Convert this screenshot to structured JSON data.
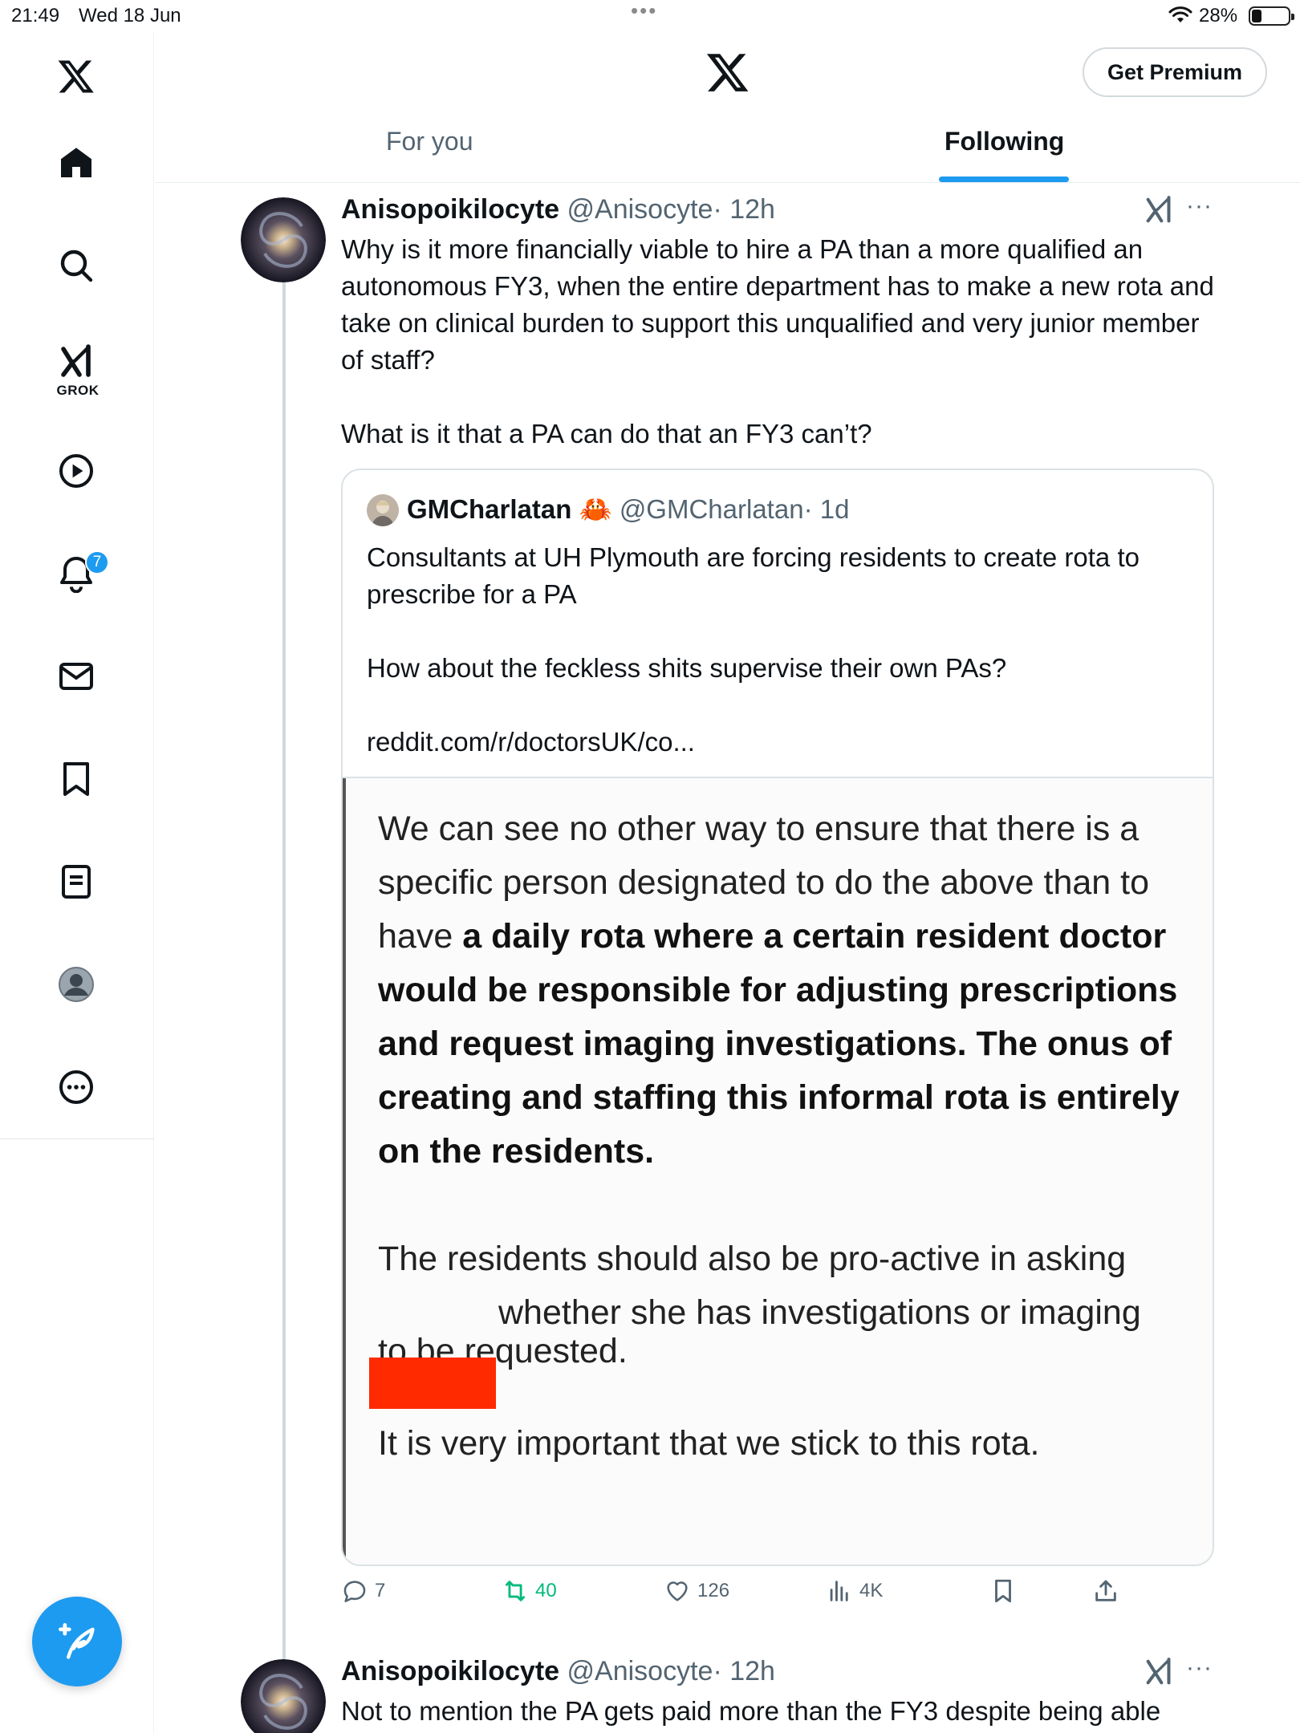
{
  "status_bar": {
    "time": "21:49",
    "date": "Wed 18 Jun",
    "battery_percent": "28%",
    "battery_level": 0.28
  },
  "sidebar": {
    "items": [
      {
        "icon": "x-logo-icon"
      },
      {
        "icon": "home-icon"
      },
      {
        "icon": "search-icon"
      },
      {
        "icon": "grok-icon",
        "label": "GROK"
      },
      {
        "icon": "play-icon"
      },
      {
        "icon": "bell-icon",
        "badge": "7"
      },
      {
        "icon": "mail-icon"
      },
      {
        "icon": "bookmark-icon"
      },
      {
        "icon": "list-icon"
      },
      {
        "icon": "profile-icon"
      },
      {
        "icon": "more-icon"
      }
    ],
    "compose_icon": "compose-icon"
  },
  "header": {
    "premium_label": "Get Premium",
    "tabs": [
      {
        "label": "For you",
        "active": false
      },
      {
        "label": "Following",
        "active": true
      }
    ],
    "accent_color": "#1d9bf0"
  },
  "tweet": {
    "author_name": "Anisopoikilocyte",
    "handle": "@Anisocyte",
    "time": "· 12h",
    "text_p1": "Why is it more financially viable to hire a PA than a more qualified an autonomous FY3, when the entire department has to make a new rota and take on clinical burden to support this unqualified and very junior member of staff?",
    "text_p2": "What is it that a PA can do that an FY3 can’t?",
    "quote": {
      "author_name": "GMCharlatan",
      "emoji": "🦀",
      "handle": "@GMCharlatan",
      "time": "· 1d",
      "text_p1": "Consultants at UH Plymouth are forcing residents to create rota to prescribe for a PA",
      "text_p2": "How about the feckless shits supervise their own PAs?",
      "link": "reddit.com/r/doctorsUK/co...",
      "image_text": {
        "p1_normal": "We can see no other way to ensure that there is a specific person designated to do the above than to have",
        "p1_bold": "a daily rota where a certain resident doctor would be responsible for adjusting prescriptions and request imaging investigations. The onus of creating and staffing this informal rota is entirely on the residents.",
        "p2_line1": "The residents should also be pro-active in asking",
        "p2_line2": "whether she has investigations or imaging",
        "p2_line3": "to be requested.",
        "p3": "It is very important that we stick to this rota."
      }
    },
    "actions": {
      "replies": "7",
      "reposts": "40",
      "likes": "126",
      "views": "4K"
    }
  },
  "tweet2": {
    "author_name": "Anisopoikilocyte",
    "handle": "@Anisocyte",
    "time": "· 12h",
    "text": "Not to mention the PA gets paid more than the FY3 despite being able"
  }
}
